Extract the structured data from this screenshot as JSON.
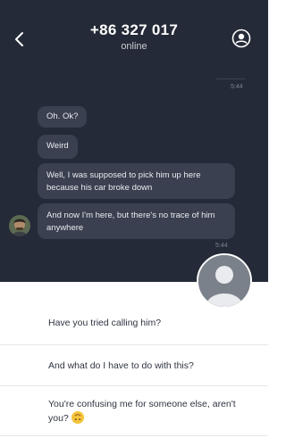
{
  "header": {
    "title": "+86 327 017",
    "status": "online"
  },
  "messages": {
    "sent_time": "5:44",
    "received": [
      "Oh. Ok?",
      "Weird",
      "Well, I was supposed to pick him up here because his car broke down",
      "And now I'm here, but there's no trace of him anywhere"
    ],
    "received_time": "5:44"
  },
  "reply_options": [
    "Have you tried calling him?",
    "And what do I have to do with this?",
    "You're confusing me for someone else, aren't you?"
  ],
  "icons": {
    "back": "chevron-left-icon",
    "profile": "user-circle-icon",
    "emoji": "upside-down-face-emoji"
  },
  "colors": {
    "chat_background": "#242a37",
    "bubble": "#3a4050",
    "options_background": "#ffffff"
  }
}
